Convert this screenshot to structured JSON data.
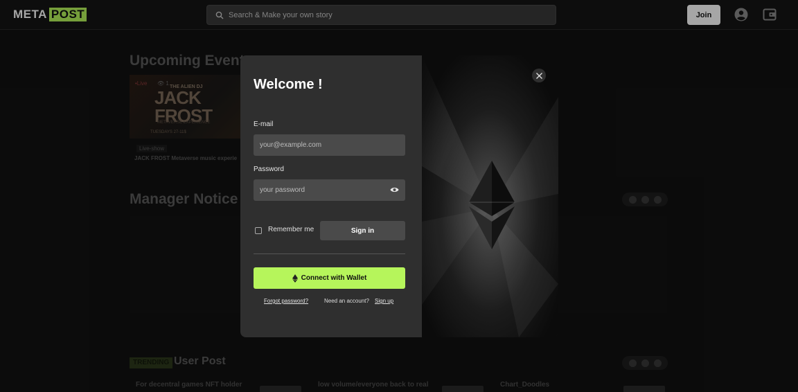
{
  "header": {
    "logo_left": "META",
    "logo_right": "POST",
    "search_placeholder": "Search & Make your own story",
    "join_label": "Join",
    "profile_icon": "user-circle-icon",
    "wallet_icon": "wallet-icon"
  },
  "background": {
    "upcoming_title": "Upcoming Event",
    "event": {
      "live": "•Live",
      "views": "👁 1",
      "tag": "Live-show",
      "caption": "JACK FROST Metaverse music experie",
      "poster_line1": "THE ALIEN DJ",
      "poster_line2": "JACK\nFROST",
      "poster_line3": "METAVERSE EXPERIENCE",
      "poster_line4": "TUESDAYS                27-11$"
    },
    "manager_title": "Manager Notice",
    "trending_badge": "TRENDING",
    "user_post_title": "User Post",
    "posts": [
      "For decentral games NFT holder",
      "low volume/everyone back to real",
      "Chart_Doodles"
    ]
  },
  "modal": {
    "title": "Welcome !",
    "email_label": "E-mail",
    "email_placeholder": "your@example.com",
    "password_label": "Password",
    "password_placeholder": "your password",
    "remember_label": "Remember me",
    "signin_label": "Sign in",
    "wallet_label": "Connect with Wallet",
    "forgot_label": "Forgot password?",
    "need_account": "Need an account?",
    "signup_label": "Sign up"
  },
  "colors": {
    "accent": "#b6f55b",
    "modal_bg": "#2f2f2f",
    "field_bg": "#4a4a4a"
  }
}
